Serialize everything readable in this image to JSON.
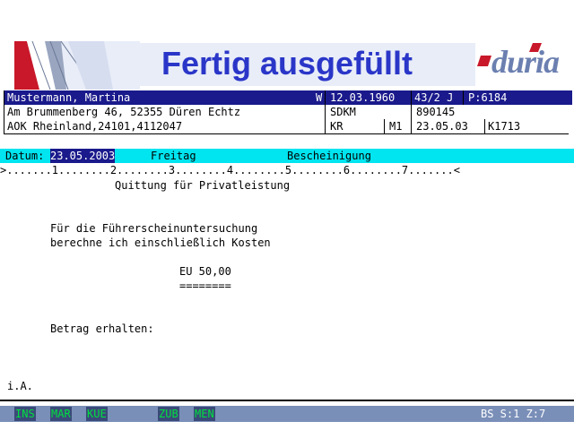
{
  "header": {
    "title": "Fertig ausgefüllt",
    "logo_text": "duria"
  },
  "patient": {
    "name": "Mustermann, Martina",
    "sex": "W",
    "birthdate": "12.03.1960",
    "age": "43/2 J",
    "patient_no": "P:6184",
    "address": "Am Brummenberg 46, 52355 Düren Echtz",
    "insurance": "AOK Rheinland,24101,4112047",
    "code1": "SDKM",
    "code2": "KR",
    "code3": "M1",
    "field1": "890145",
    "date2": "23.05.03",
    "field2": "K1713"
  },
  "infobar": {
    "date_label": "Datum:",
    "date_value": "23.05.2003",
    "weekday": "Freitag",
    "doc_type": "Bescheinigung"
  },
  "ruler": ">.......1........2........3........4........5........6........7.......<",
  "document": {
    "heading": "Quittung für Privatleistung",
    "line1": "Für die Führerscheinuntersuchung",
    "line2": "berechne ich einschließlich Kosten",
    "amount": "EU 50,00",
    "underline": "========",
    "received": "Betrag erhalten:",
    "signature": "i.A."
  },
  "statusbar": {
    "keys": [
      "INS",
      "MAR",
      "KUE",
      "ZUB",
      "MEN"
    ],
    "status": "BS S:1 Z:7"
  },
  "colors": {
    "title": "#2a36c8",
    "patient_bar": "#1a1a8c",
    "info_bar": "#00e5f0",
    "status_bar": "#7a8fb8",
    "status_key": "#00e040"
  }
}
